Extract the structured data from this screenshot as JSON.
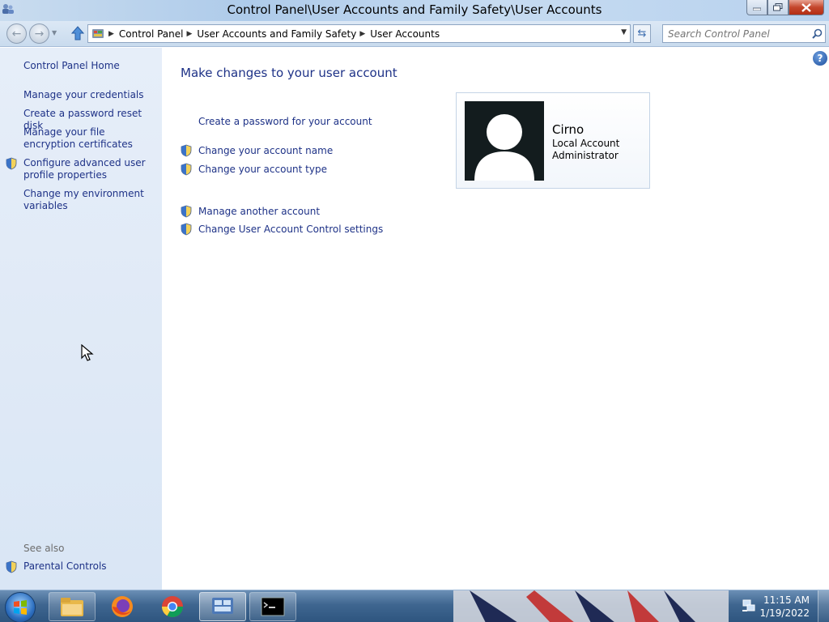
{
  "window": {
    "title": "Control Panel\\User Accounts and Family Safety\\User Accounts"
  },
  "address": {
    "breadcrumbs": [
      "Control Panel",
      "User Accounts and Family Safety",
      "User Accounts"
    ]
  },
  "search": {
    "placeholder": "Search Control Panel"
  },
  "sidebar": {
    "home": "Control Panel Home",
    "items": [
      "Manage your credentials",
      "Create a password reset disk",
      "Manage your file encryption certificates",
      "Configure advanced user profile properties",
      "Change my environment variables"
    ],
    "see_also_label": "See also",
    "see_also_items": [
      "Parental Controls"
    ]
  },
  "main": {
    "heading": "Make changes to your user account",
    "tasks": [
      "Create a password for your account",
      "Change your account name",
      "Change your account type",
      "Manage another account",
      "Change User Account Control settings"
    ]
  },
  "account": {
    "name": "Cirno",
    "type": "Local Account",
    "role": "Administrator"
  },
  "taskbar": {
    "time": "11:15 AM",
    "date": "1/19/2022"
  },
  "icons": {
    "app": "user-accounts-icon",
    "shield": "uac-shield-icon",
    "help": "help-icon",
    "search": "search-icon",
    "refresh": "refresh-icon"
  },
  "colors": {
    "link": "#1e3287",
    "sidebar_bg": "#e3ecf8",
    "close_button": "#c4462c"
  }
}
